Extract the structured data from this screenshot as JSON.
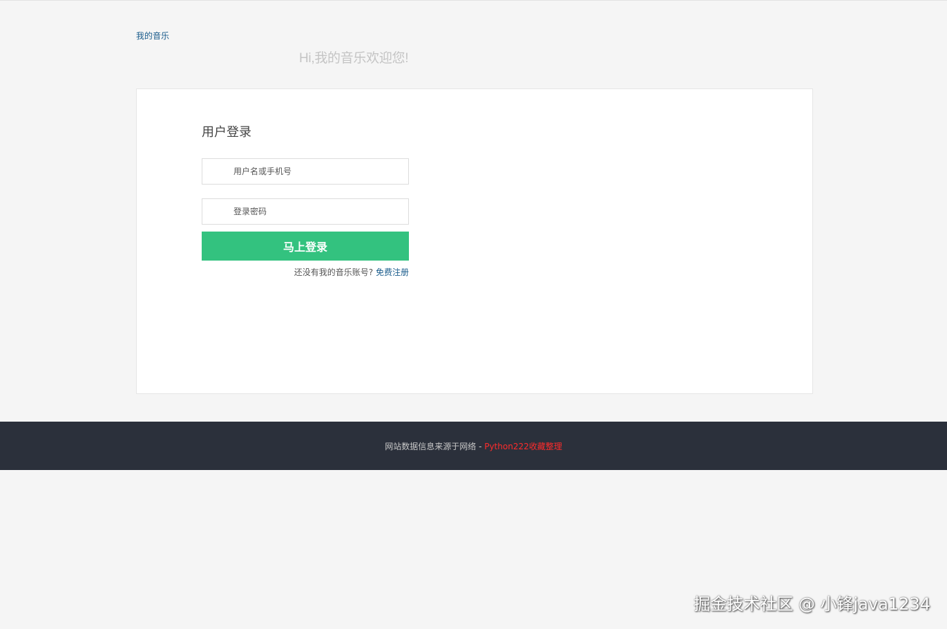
{
  "header": {
    "brand": "我的音乐",
    "welcome": "Hi,我的音乐欢迎您!"
  },
  "login": {
    "title": "用户登录",
    "username_placeholder": "用户名或手机号",
    "password_placeholder": "登录密码",
    "submit_label": "马上登录",
    "no_account_text": "还没有我的音乐账号?",
    "register_label": "免费注册"
  },
  "footer": {
    "text": "网站数据信息来源于网络 - ",
    "credit": "Python222收藏整理"
  },
  "watermark": "掘金技术社区 @ 小锋java1234",
  "colors": {
    "background": "#f5f5f5",
    "primary_button": "#33c27f",
    "link": "#1a5c8c",
    "footer_bg": "#2b303b",
    "footer_credit": "#ff2b2b"
  }
}
